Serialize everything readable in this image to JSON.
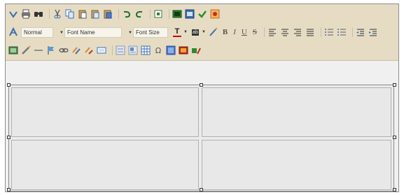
{
  "toolbar": {
    "row1_icons": [
      "spellcheck-icon",
      "print-icon",
      "find-icon",
      "cut-icon",
      "copy-icon",
      "paste-icon",
      "paste-text-icon",
      "paste-word-icon",
      "undo-icon",
      "redo-icon",
      "select-all-icon",
      "image-icon",
      "preview-icon",
      "check-icon",
      "special-icon"
    ],
    "style_select": "Normal",
    "font_select": "Font Name",
    "size_select": "Font Size",
    "text_color_label": "T",
    "bg_color_label": "ab",
    "bold_label": "B",
    "italic_label": "I",
    "underline_label": "U",
    "strike_label": "S"
  },
  "colors": {
    "toolbar_bg": "#e6dcc4",
    "text_color_bar": "#cc0000",
    "canvas_bg": "#f0f0f0"
  }
}
